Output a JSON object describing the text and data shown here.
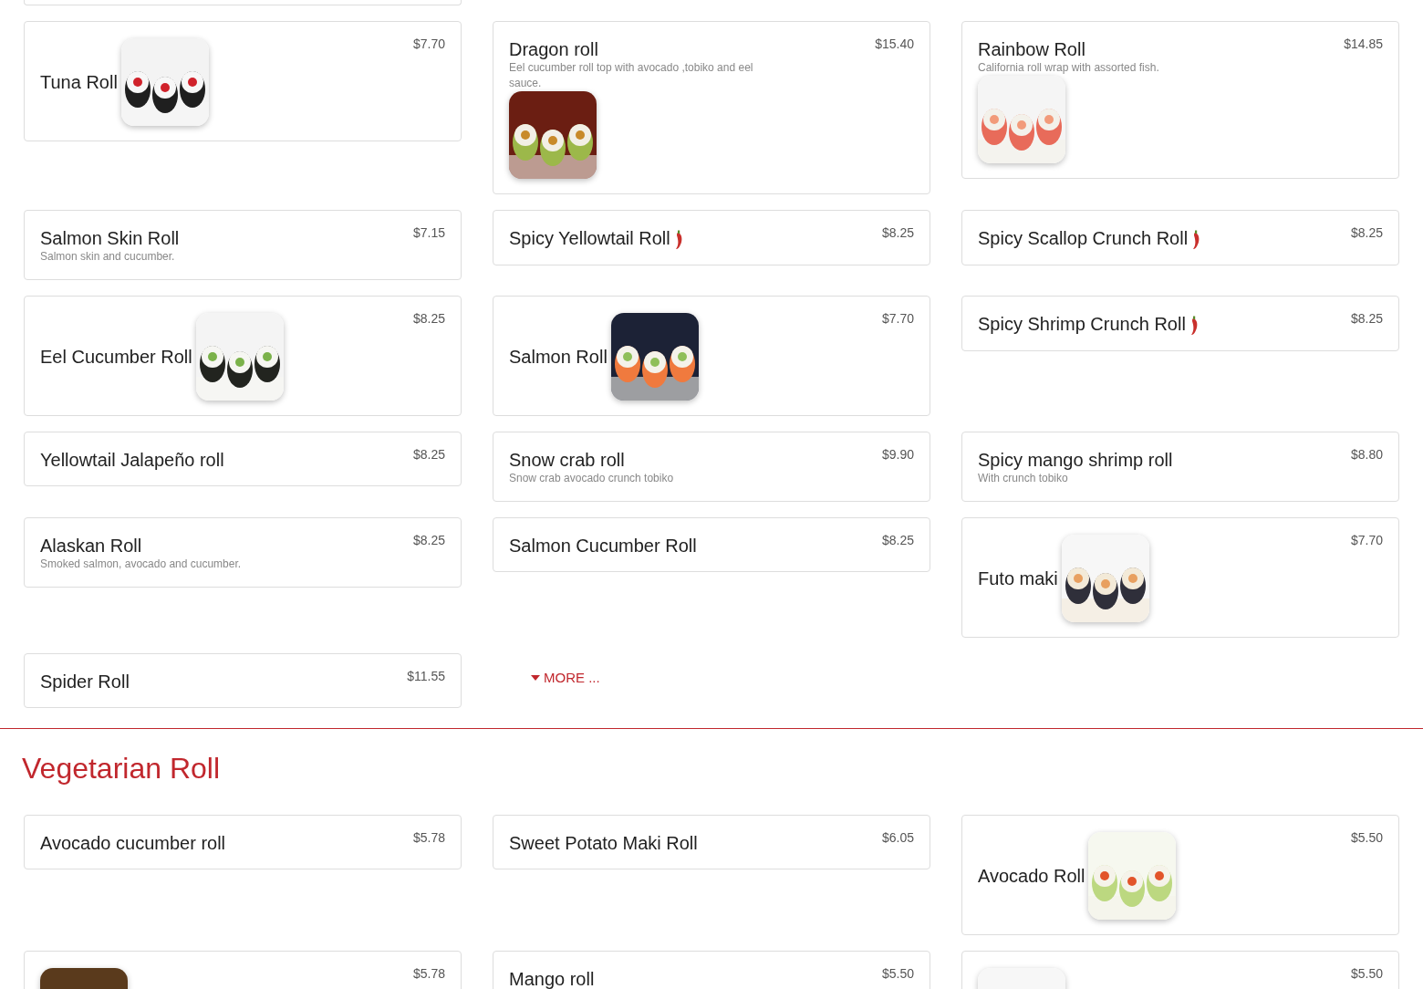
{
  "sections": [
    {
      "leading_stub": true,
      "items": [
        {
          "kind": "inline",
          "name": "Tuna Roll",
          "price": "$7.70",
          "spicy": false
        },
        {
          "kind": "stacked",
          "name": "Dragon roll",
          "description": "Eel cucumber roll top with avocado ,tobiko and eel sauce.",
          "price": "$15.40",
          "spicy": false
        },
        {
          "kind": "stacked",
          "name": "Rainbow Roll",
          "description": "California roll wrap with assorted fish.",
          "price": "$14.85",
          "spicy": false
        },
        {
          "kind": "stacked",
          "name": "Salmon Skin Roll",
          "description": "Salmon skin and cucumber.",
          "price": "$7.15",
          "spicy": false
        },
        {
          "kind": "stacked",
          "name": "Spicy Yellowtail Roll",
          "price": "$8.25",
          "spicy": true
        },
        {
          "kind": "stacked",
          "name": "Spicy Scallop Crunch Roll",
          "price": "$8.25",
          "spicy": true
        },
        {
          "kind": "inline",
          "name": "Eel Cucumber Roll",
          "price": "$8.25",
          "spicy": false
        },
        {
          "kind": "inline",
          "name": "Salmon Roll",
          "price": "$7.70",
          "spicy": false
        },
        {
          "kind": "stacked",
          "name": "Spicy Shrimp Crunch Roll",
          "price": "$8.25",
          "spicy": true
        },
        {
          "kind": "stacked",
          "name": "Yellowtail Jalapeño roll",
          "price": "$8.25",
          "spicy": false
        },
        {
          "kind": "stacked",
          "name": "Snow crab roll",
          "description": "Snow crab avocado crunch tobiko",
          "price": "$9.90",
          "spicy": false
        },
        {
          "kind": "stacked",
          "name": "Spicy mango shrimp roll",
          "description": "With crunch tobiko",
          "price": "$8.80",
          "spicy": false
        },
        {
          "kind": "stacked",
          "name": "Alaskan Roll",
          "description": "Smoked salmon, avocado and cucumber.",
          "price": "$8.25",
          "spicy": false
        },
        {
          "kind": "stacked",
          "name": "Salmon Cucumber Roll",
          "price": "$8.25",
          "spicy": false
        },
        {
          "kind": "inline",
          "name": "Futo maki",
          "price": "$7.70",
          "spicy": false
        },
        {
          "kind": "stacked",
          "name": "Spider Roll",
          "price": "$11.55",
          "spicy": false
        }
      ],
      "more_button": "MORE ..."
    },
    {
      "heading": "Vegetarian Roll",
      "leading_stub": false,
      "items": [
        {
          "kind": "stacked",
          "name": "Avocado cucumber roll",
          "price": "$5.78",
          "spicy": false
        },
        {
          "kind": "stacked",
          "name": "Sweet Potato Maki Roll",
          "price": "$6.05",
          "spicy": false
        },
        {
          "kind": "inline",
          "name": "Avocado Roll",
          "price": "$5.50",
          "spicy": false
        },
        {
          "kind": "inline",
          "price": "$5.78",
          "spicy": false
        },
        {
          "kind": "stacked",
          "name": "Mango roll",
          "price": "$5.50",
          "spicy": false
        },
        {
          "kind": "inline",
          "price": "$5.50",
          "spicy": false
        }
      ]
    }
  ]
}
